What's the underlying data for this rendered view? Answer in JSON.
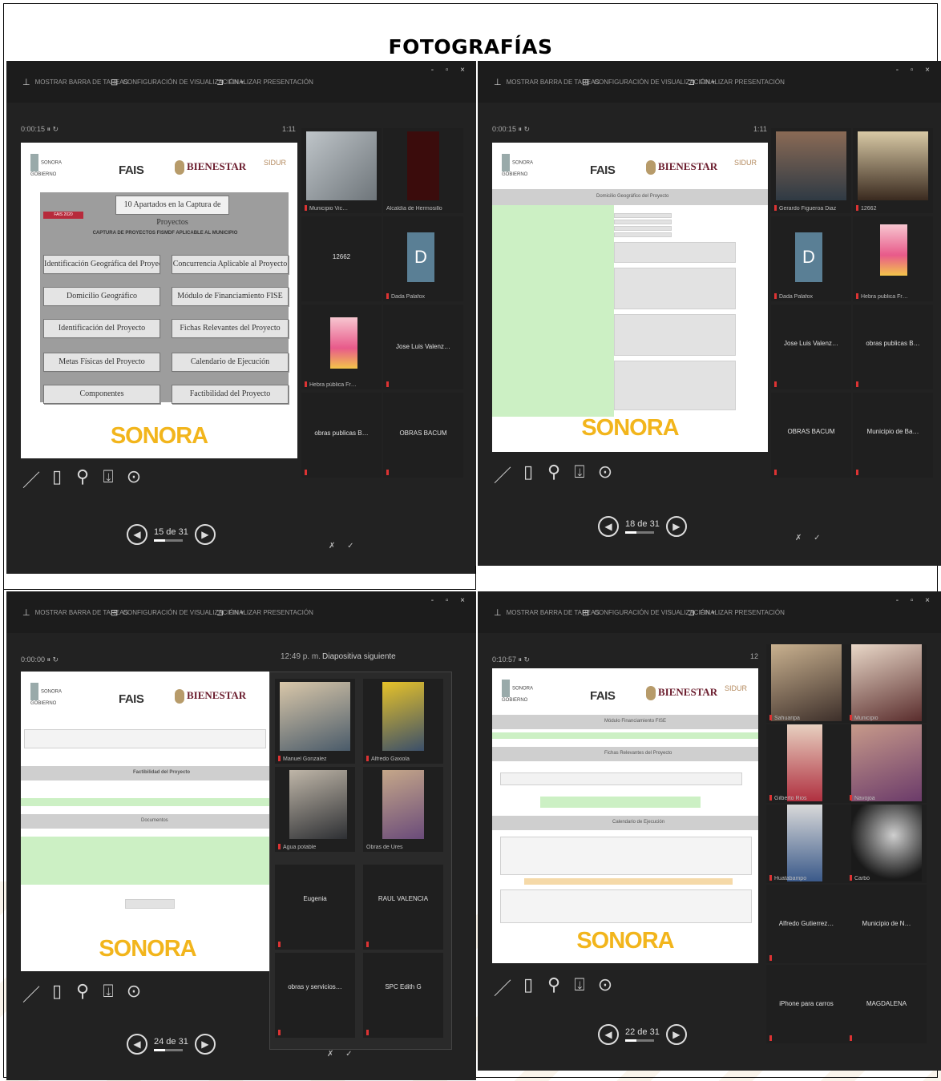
{
  "page_title": "FOTOGRAFÍAS",
  "menu": {
    "item1": "MOSTRAR BARRA DE TAREAS",
    "item2": "CONFIGURACIÓN DE VISUALIZACIÓN ▾",
    "item3": "FINALIZAR PRESENTACIÓN",
    "window_controls": "- ▫ ×"
  },
  "logos": {
    "gob_line1": "SONORA",
    "gob_line2": "GOBIERNO",
    "fais": "FAIS",
    "bienestar": "BIENESTAR",
    "sider": "SIDUR",
    "sonora": "SONORA"
  },
  "panels": [
    {
      "slide_num": "0:00:15  ⏸ ↻",
      "time": "1:11",
      "slide_title": "10 Apartados en la Captura de Proyectos",
      "red_tag": "FAIS 2020",
      "capture_title": "CAPTURA DE PROYECTOS FISMDF APLICABLE AL MUNICIPIO",
      "buttons": [
        "Identificación Geográfica del Proyecto",
        "Concurrencia Aplicable al Proyecto",
        "Domicilio Geográfico",
        "Módulo de Financiamiento FISE",
        "Identificación del Proyecto",
        "Fichas Relevantes del Proyecto",
        "Metas Físicas del Proyecto",
        "Calendario de Ejecución",
        "Componentes",
        "Factibilidad del Proyecto"
      ],
      "nav": "15 de 31",
      "participants": [
        {
          "name": "Municipio Vic…",
          "type": "video"
        },
        {
          "name": "Alcaldía de Hermosillo",
          "type": "video-dark"
        },
        {
          "name": "12662",
          "type": "label"
        },
        {
          "name": "Dada Palafox",
          "type": "avatar",
          "initial": "D"
        },
        {
          "name": "Hebra pública Fr…",
          "type": "pink"
        },
        {
          "name": "Jose Luis Valenz…",
          "type": "label"
        },
        {
          "name": "obras publicas B…",
          "type": "label"
        },
        {
          "name": "OBRAS BACUM",
          "type": "label"
        }
      ]
    },
    {
      "slide_num": "0:00:15  ⏸ ↻",
      "time": "1:11",
      "form_title": "Domicilio Geográfico del Proyecto",
      "nav": "18 de 31",
      "participants": [
        {
          "name": "Gerardo Figueroa Diaz",
          "type": "video"
        },
        {
          "name": "12662",
          "type": "video"
        },
        {
          "name": "Dada Palafox",
          "type": "avatar",
          "initial": "D"
        },
        {
          "name": "Hebra publica Fr…",
          "type": "pink"
        },
        {
          "name": "Jose Luis Valenz…",
          "type": "label"
        },
        {
          "name": "obras publicas B…",
          "type": "label"
        },
        {
          "name": "OBRAS BACUM",
          "type": "label"
        },
        {
          "name": "Municipio de Ba…",
          "type": "label"
        }
      ]
    },
    {
      "slide_num": "0:00:00  ⏸ ↻",
      "time": "12:49 p. m.",
      "next_label": "Diapositiva siguiente",
      "section_1": "Factibilidad del Proyecto",
      "section_2": "Documentos",
      "nav": "24 de 31",
      "participants": [
        {
          "name": "Manuel Gonzalez",
          "type": "video"
        },
        {
          "name": "Alfredo Gaxiola",
          "type": "video"
        },
        {
          "name": "Agua potable",
          "type": "video"
        },
        {
          "name": "Obras de Ures",
          "type": "video"
        },
        {
          "name": "Eugenia",
          "type": "label"
        },
        {
          "name": "RAUL VALENCIA",
          "type": "label"
        },
        {
          "name": "obras y servicios…",
          "type": "label"
        },
        {
          "name": "SPC Edith G",
          "type": "label"
        }
      ]
    },
    {
      "slide_num": "0:10:57  ⏸ ↻",
      "time": "12",
      "form_title_1": "Módulo Financiamiento FISE",
      "form_title_2": "Fichas Relevantes del Proyecto",
      "form_title_3": "Calendario de Ejecución",
      "nav": "22 de 31",
      "participants": [
        {
          "name": "Sahuaripa",
          "type": "video"
        },
        {
          "name": "Municipio",
          "type": "video"
        },
        {
          "name": "Gilberto Rios",
          "type": "video"
        },
        {
          "name": "Navojoa",
          "type": "video"
        },
        {
          "name": "Huatabampo",
          "type": "video"
        },
        {
          "name": "Carbó",
          "type": "video-dark"
        },
        {
          "name": "Alfredo Gutierrez…",
          "type": "label"
        },
        {
          "name": "Municipio de N…",
          "type": "label"
        },
        {
          "name": "iPhone para carros",
          "type": "label"
        },
        {
          "name": "MAGDALENA",
          "type": "label"
        }
      ]
    }
  ]
}
